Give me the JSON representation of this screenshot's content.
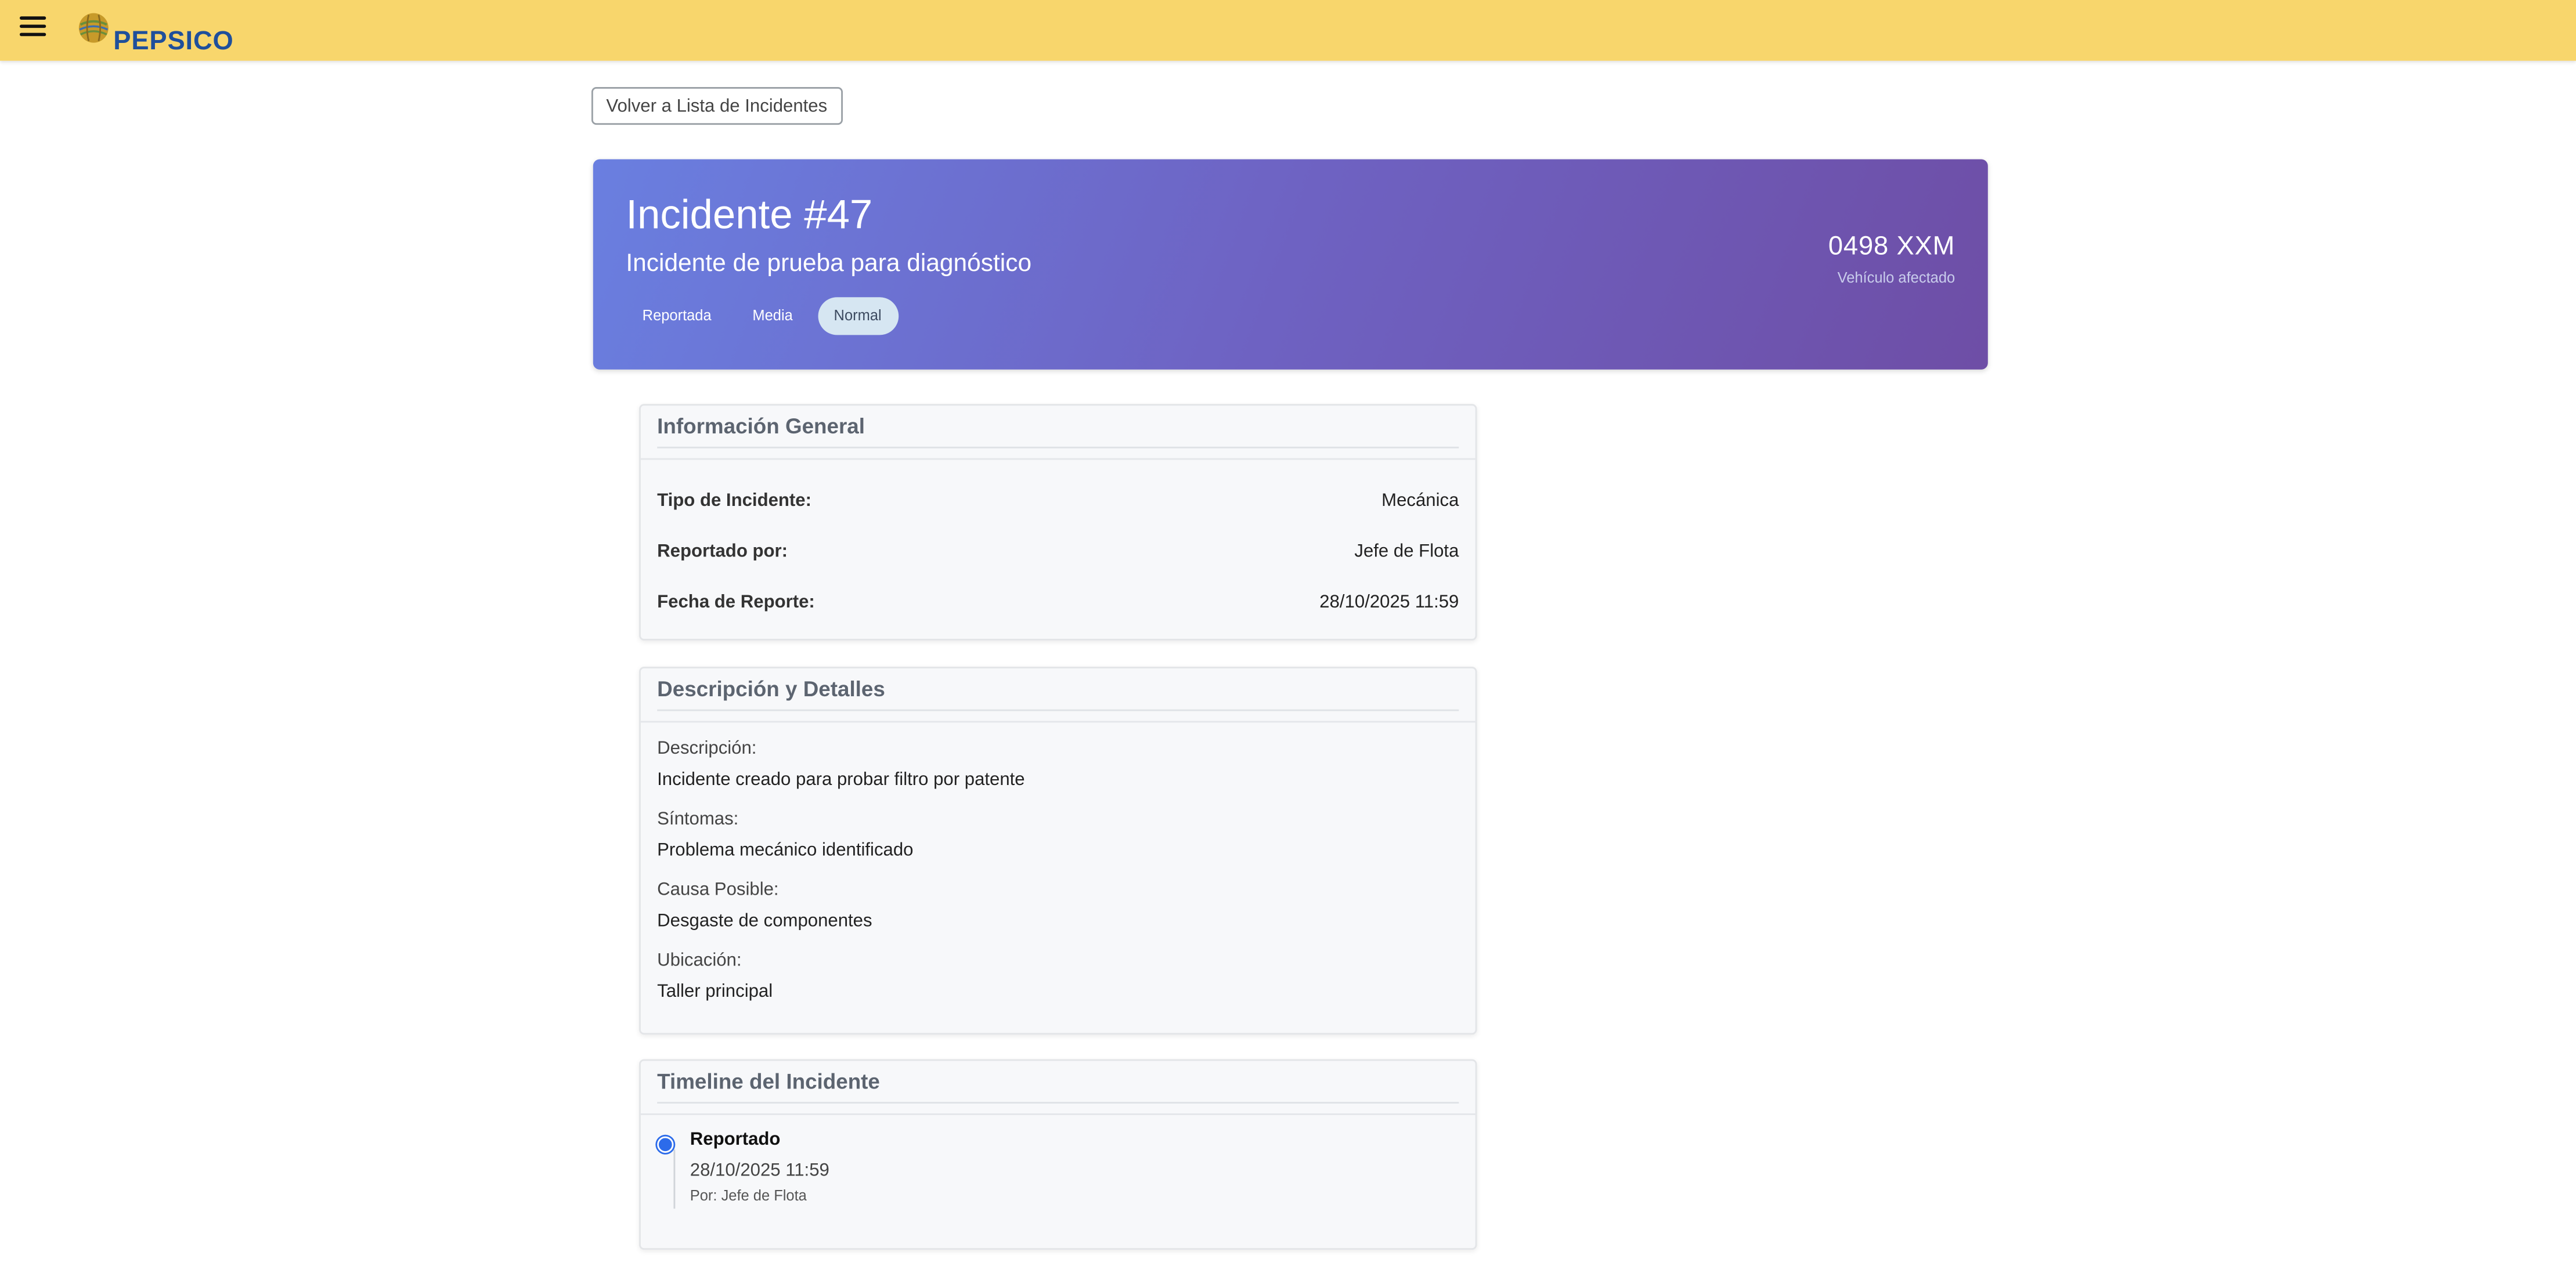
{
  "topbar": {
    "menu_icon": "hamburger-menu-icon",
    "logo_icon": "pepsico-globe-icon",
    "brand": "PEPSICO",
    "brand_color": "#1f4f9b",
    "bar_color": "#f8d66c"
  },
  "nav": {
    "back_label": "Volver a Lista de Incidentes"
  },
  "hero": {
    "title": "Incidente #47",
    "subtitle": "Incidente de prueba para diagnóstico",
    "badges": {
      "status": "Reportada",
      "priority": "Media",
      "severity": "Normal"
    },
    "plate": "0498 XXM",
    "plate_label": "Vehículo afectado"
  },
  "general": {
    "title": "Información General",
    "rows": [
      {
        "label": "Tipo de Incidente:",
        "value": "Mecánica"
      },
      {
        "label": "Reportado por:",
        "value": "Jefe de Flota"
      },
      {
        "label": "Fecha de Reporte:",
        "value": "28/10/2025 11:59"
      }
    ]
  },
  "details": {
    "title": "Descripción y Detalles",
    "items": [
      {
        "label": "Descripción:",
        "value": "Incidente creado para probar filtro por patente"
      },
      {
        "label": "Síntomas:",
        "value": "Problema mecánico identificado"
      },
      {
        "label": "Causa Posible:",
        "value": "Desgaste de componentes"
      },
      {
        "label": "Ubicación:",
        "value": "Taller principal"
      }
    ]
  },
  "timeline": {
    "title": "Timeline del Incidente",
    "items": [
      {
        "status": "Reportado",
        "date": "28/10/2025 11:59",
        "by": "Por: Jefe de Flota",
        "dot_color": "#2c6bea"
      }
    ]
  }
}
